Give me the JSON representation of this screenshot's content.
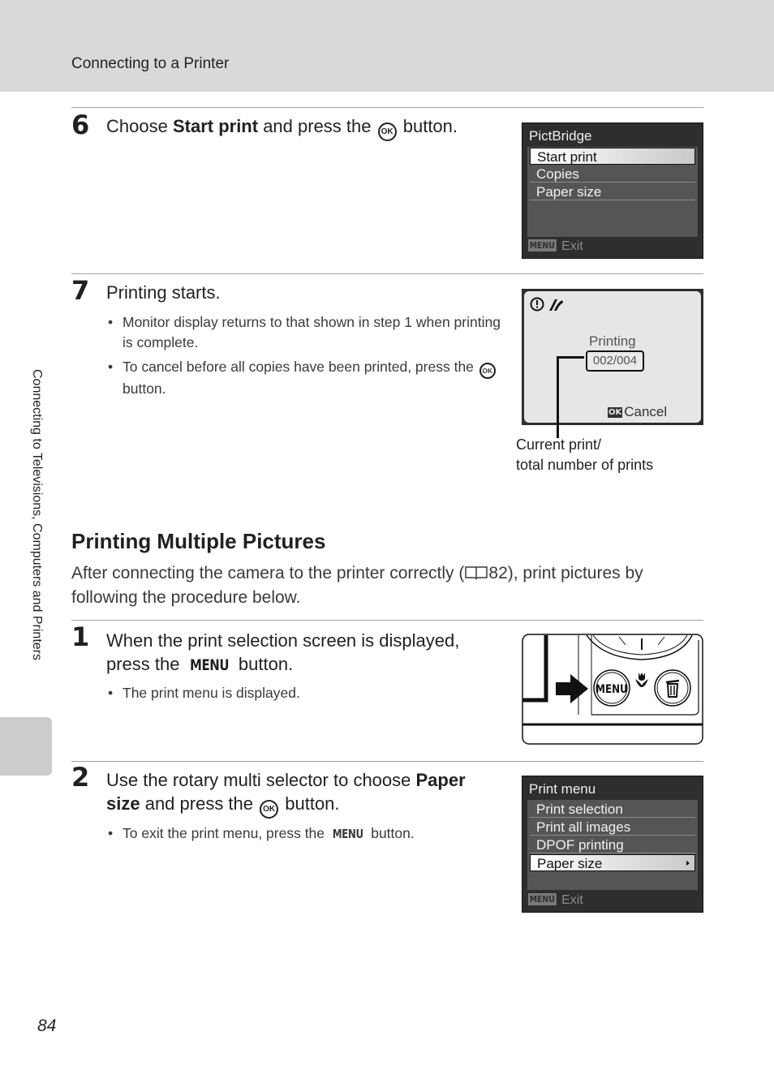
{
  "header": {
    "title": "Connecting to a Printer"
  },
  "side_tab": {
    "label": "Connecting to Televisions, Computers and Printers"
  },
  "page_number": "84",
  "steps_top": [
    {
      "number": "6",
      "title_pre": "Choose ",
      "title_bold": "Start print",
      "title_post_before_icon": " and press the ",
      "title_icon": "OK",
      "title_post": " button."
    },
    {
      "number": "7",
      "title": "Printing starts.",
      "bullets": [
        {
          "text": "Monitor display returns to that shown in step 1 when printing is complete."
        },
        {
          "text_pre": "To cancel before all copies have been printed, press the ",
          "icon": "OK",
          "text_post": " button."
        }
      ]
    }
  ],
  "pictbridge_screen": {
    "title": "PictBridge",
    "items": [
      "Start print",
      "Copies",
      "Paper size"
    ],
    "selected_index": 0,
    "footer_badge": "MENU",
    "footer_label": "Exit"
  },
  "printing_screen": {
    "icons": [
      "warning-icon",
      "pictbridge-icon"
    ],
    "label": "Printing",
    "counter": "002/004",
    "current": 2,
    "total": 4,
    "cancel_badge": "OK",
    "cancel_label": "Cancel",
    "caption_line1": "Current print/",
    "caption_line2": "total number of prints"
  },
  "section": {
    "title": "Printing Multiple Pictures",
    "intro_pre": "After connecting the camera to the printer correctly (",
    "intro_ref_icon": "book-icon",
    "intro_ref": "82",
    "intro_post": "), print pictures by following the procedure below."
  },
  "steps_bottom": [
    {
      "number": "1",
      "title_pre": "When the print selection screen is displayed, press the ",
      "title_icon": "MENU",
      "title_post": " button.",
      "bullets": [
        {
          "text": "The print menu is displayed."
        }
      ]
    },
    {
      "number": "2",
      "title_pre": "Use the rotary multi selector to choose ",
      "title_bold": "Paper size",
      "title_mid": " and press the ",
      "title_icon": "OK",
      "title_post": " button.",
      "bullets": [
        {
          "text_pre": "To exit the print menu, press the ",
          "icon": "MENU",
          "text_post": " button."
        }
      ]
    }
  ],
  "camera_illustration": {
    "menu_button_label": "MENU"
  },
  "print_menu_screen": {
    "title": "Print menu",
    "items": [
      "Print selection",
      "Print all images",
      "DPOF printing",
      "Paper size"
    ],
    "selected_index": 3,
    "footer_badge": "MENU",
    "footer_label": "Exit"
  }
}
